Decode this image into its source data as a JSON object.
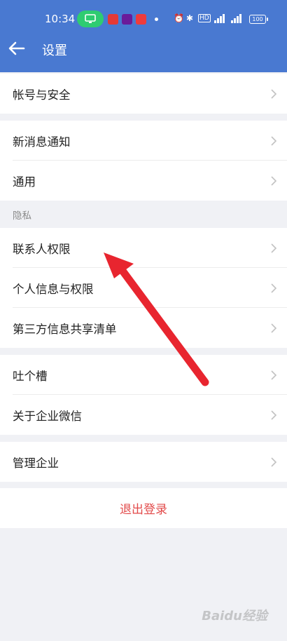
{
  "status_bar": {
    "time": "10:34",
    "battery": "100"
  },
  "header": {
    "title": "设置"
  },
  "groups": {
    "account": {
      "items": [
        {
          "label": "帐号与安全"
        }
      ]
    },
    "general": {
      "items": [
        {
          "label": "新消息通知"
        },
        {
          "label": "通用"
        }
      ]
    },
    "privacy": {
      "title": "隐私",
      "items": [
        {
          "label": "联系人权限"
        },
        {
          "label": "个人信息与权限"
        },
        {
          "label": "第三方信息共享清单"
        }
      ]
    },
    "feedback": {
      "items": [
        {
          "label": "吐个槽"
        },
        {
          "label": "关于企业微信"
        }
      ]
    },
    "manage": {
      "items": [
        {
          "label": "管理企业"
        }
      ]
    }
  },
  "logout": {
    "label": "退出登录"
  },
  "watermark": {
    "text": "Baidu经验"
  },
  "colors": {
    "header": "#4979d1",
    "logout": "#e24a4a",
    "annotation_arrow": "#e8252f"
  },
  "icons": [
    "back-arrow-icon",
    "chevron-right-icon"
  ]
}
